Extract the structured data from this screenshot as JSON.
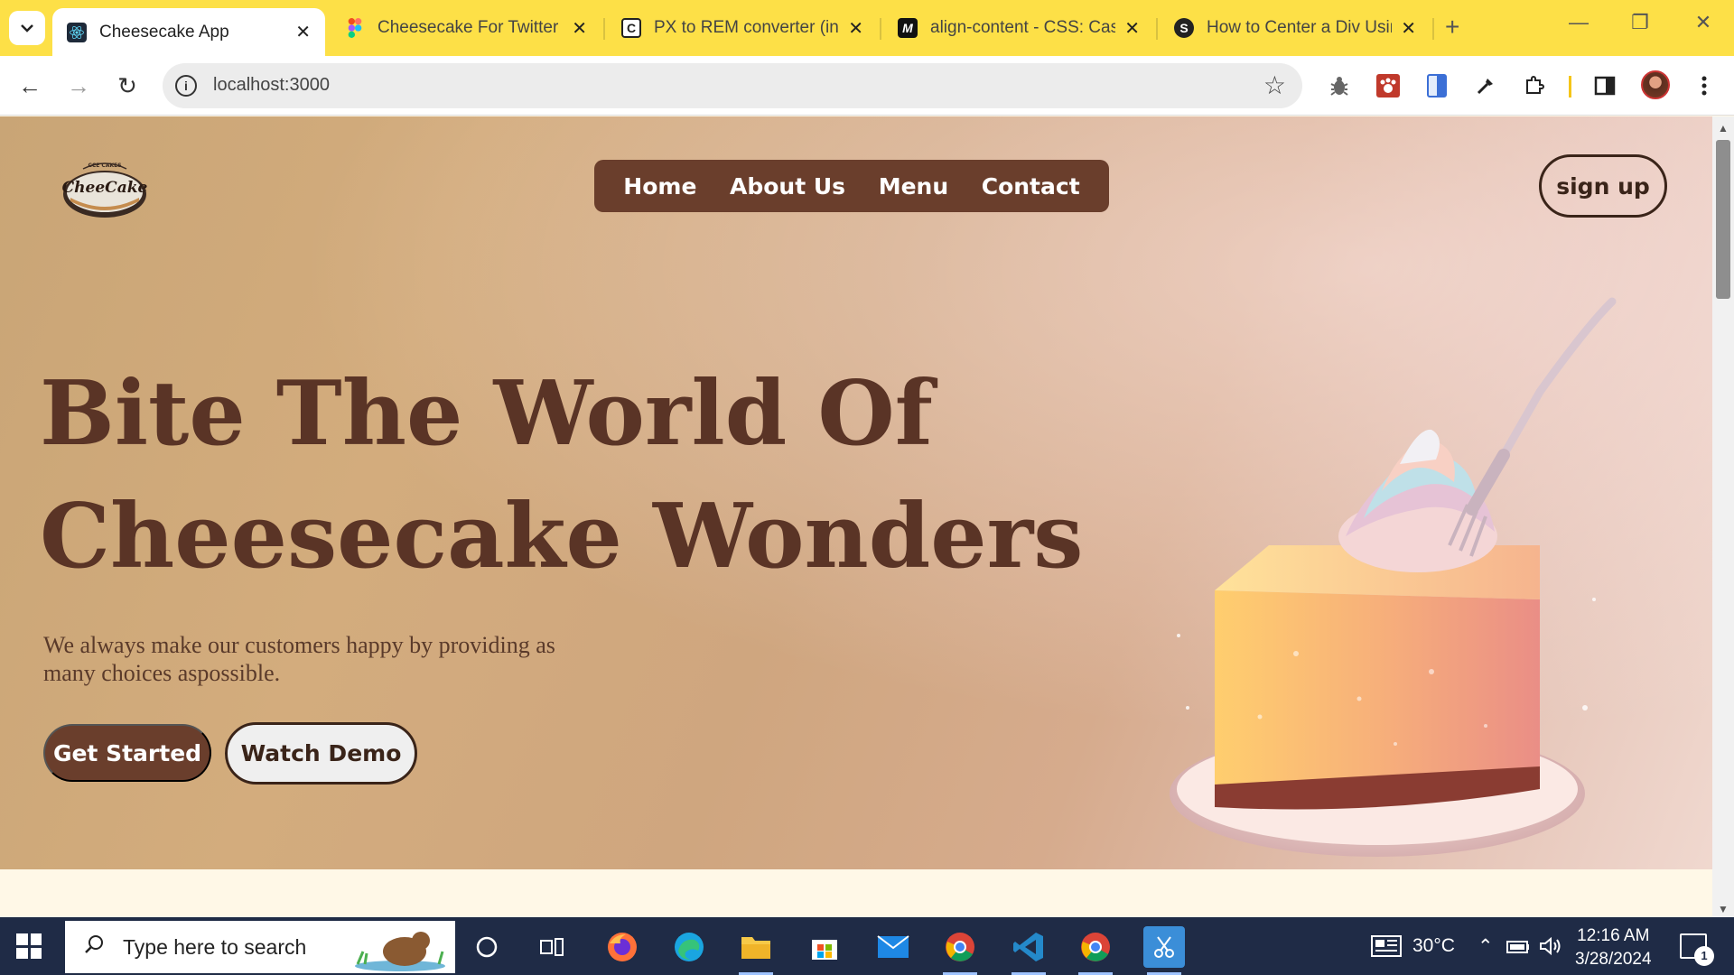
{
  "browser": {
    "tabs": [
      {
        "title": "Cheesecake App",
        "favicon": "react-icon",
        "active": true
      },
      {
        "title": "Cheesecake For Twitter –",
        "favicon": "figma-icon",
        "active": false
      },
      {
        "title": "PX to REM converter (insi",
        "favicon": "c-icon",
        "active": false
      },
      {
        "title": "align-content - CSS: Casc",
        "favicon": "mdn-icon",
        "active": false
      },
      {
        "title": "How to Center a Div Usin",
        "favicon": "site-icon",
        "active": false
      }
    ],
    "url": "localhost:3000"
  },
  "site": {
    "logo_text": "CheeCake",
    "logo_top_text": "CCE CAKES",
    "nav": [
      "Home",
      "About Us",
      "Menu",
      "Contact"
    ],
    "signup": "sign up",
    "headline_line1": "Bite The World Of",
    "headline_line2": "Cheesecake Wonders",
    "subtext": "We always make our customers happy by providing as many choices aspossible.",
    "cta_primary": "Get Started",
    "cta_secondary": "Watch Demo"
  },
  "taskbar": {
    "search_placeholder": "Type here to search",
    "apps": [
      "cortana-icon",
      "task-view-icon",
      "firefox-icon",
      "edge-icon",
      "file-explorer-icon",
      "store-icon",
      "mail-icon",
      "chrome-icon",
      "vscode-icon",
      "chrome-icon",
      "snipping-tool-icon"
    ],
    "temperature": "30°C",
    "time": "12:16 AM",
    "date": "3/28/2024",
    "notification_count": "1"
  },
  "colors": {
    "tab_strip": "#fde047",
    "brand_brown": "#6a3e2c",
    "headline": "#5a3426",
    "taskbar": "#1f2b46"
  }
}
